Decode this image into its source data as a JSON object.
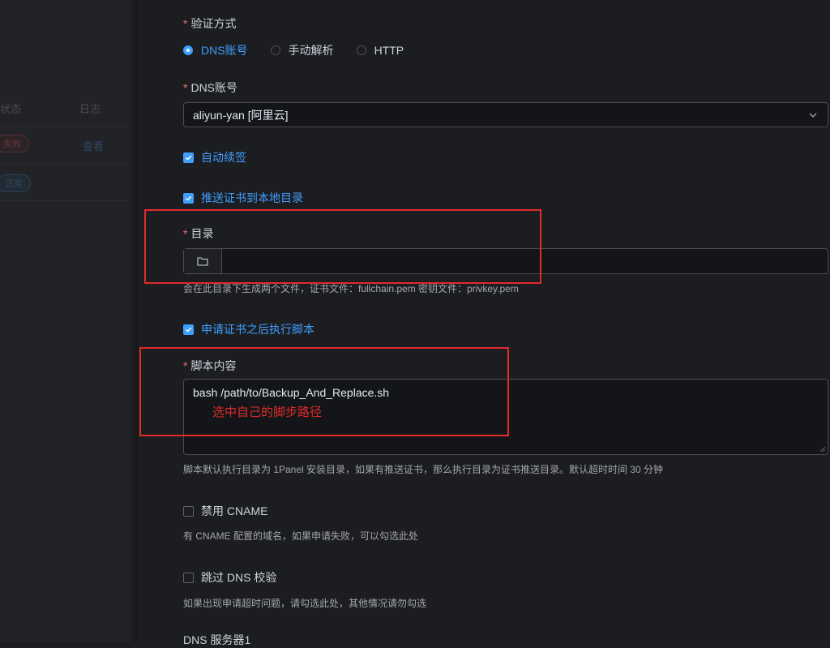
{
  "background_list": {
    "headers": {
      "status": "状态",
      "log": "日志"
    },
    "rows": [
      {
        "status": "失败",
        "log": "查看"
      },
      {
        "status": "正常"
      }
    ]
  },
  "form": {
    "verify_method": {
      "label": "验证方式",
      "options": [
        "DNS账号",
        "手动解析",
        "HTTP"
      ],
      "selected": "DNS账号"
    },
    "dns_account": {
      "label": "DNS账号",
      "value": "aliyun-yan [阿里云]"
    },
    "auto_renew": {
      "label": "自动续签",
      "checked": true
    },
    "push_to_local": {
      "label": "推送证书到本地目录",
      "checked": true
    },
    "directory": {
      "label": "目录",
      "value": "",
      "hint": "会在此目录下生成两个文件，证书文件：fullchain.pem 密钥文件：privkey.pem"
    },
    "exec_script": {
      "label": "申请证书之后执行脚本",
      "checked": true
    },
    "script_content": {
      "label": "脚本内容",
      "value": "bash  /path/to/Backup_And_Replace.sh",
      "hint": "脚本默认执行目录为 1Panel 安装目录，如果有推送证书，那么执行目录为证书推送目录。默认超时时间 30 分钟"
    },
    "disable_cname": {
      "label": "禁用 CNAME",
      "checked": false,
      "hint": "有 CNAME 配置的域名，如果申请失败，可以勾选此处"
    },
    "skip_dns_check": {
      "label": "跳过 DNS 校验",
      "checked": false,
      "hint": "如果出现申请超时问题，请勾选此处，其他情况请勿勾选"
    },
    "dns_server1": {
      "label": "DNS 服务器1"
    }
  },
  "annotation": {
    "text": "选中自己的脚步路径",
    "color": "#e02b2b"
  },
  "colors": {
    "accent": "#409eff",
    "required": "#f56c6c",
    "annotation": "#e02b2b"
  }
}
